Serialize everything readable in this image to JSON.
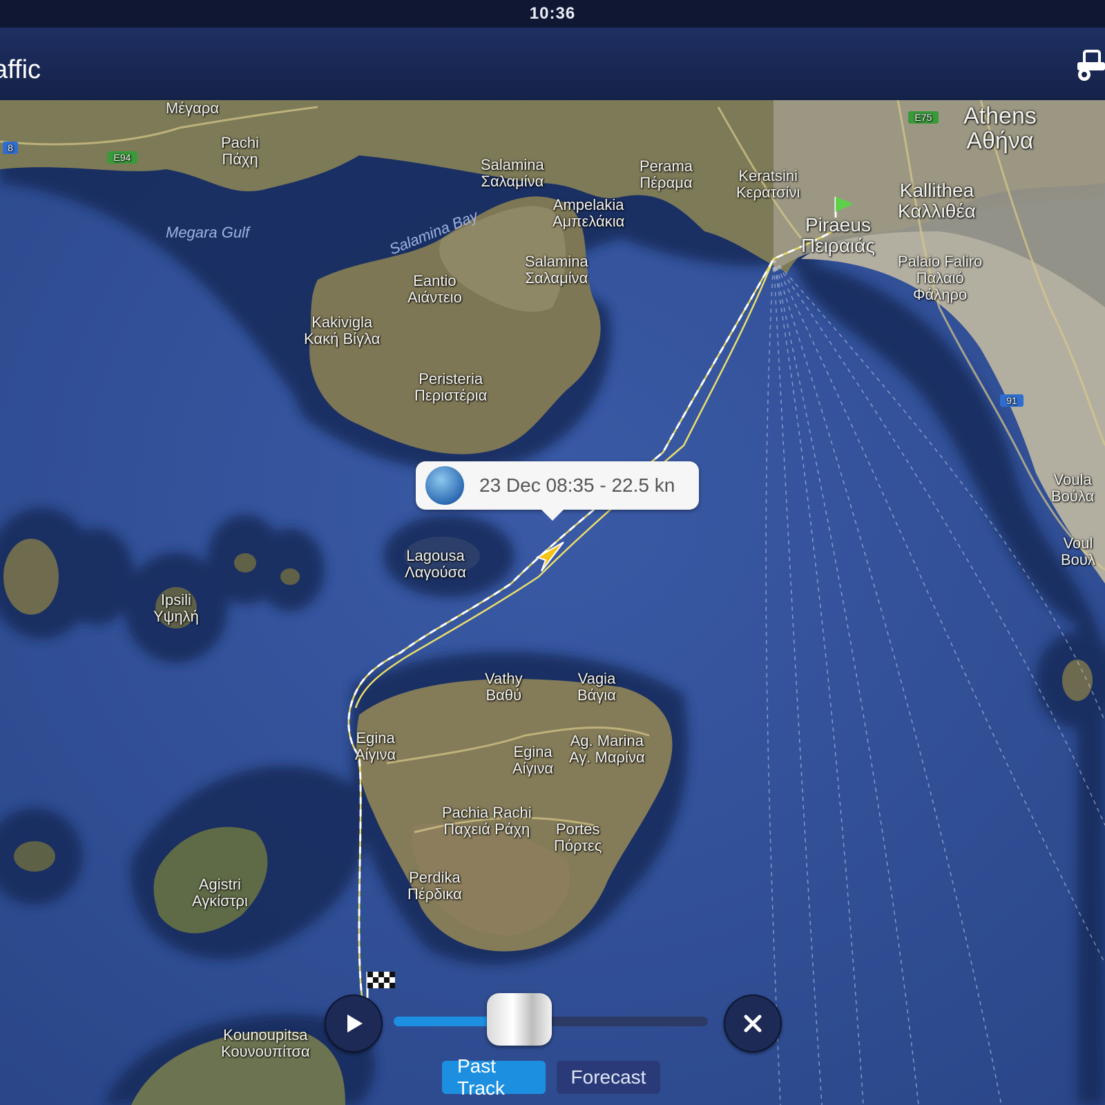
{
  "status_bar": {
    "time": "10:36"
  },
  "nav": {
    "title": "affic",
    "right_icon": "tractor-icon"
  },
  "map": {
    "places": {
      "megara": "Μέγαρα",
      "pachi": "Pachi\nΠάχη",
      "salamina_n": "Salamina\nΣαλαμίνα",
      "perama": "Perama\nΠέραμα",
      "keratsini": "Keratsini\nΚερατσίνι",
      "athens": "Athens\nΑθήνα",
      "kallithea": "Kallithea\nΚαλλιθέα",
      "piraeus": "Piraeus\nΠειραιάς",
      "ampelakia": "Ampelakia\nΑμπελάκια",
      "salamina_c": "Salamina\nΣαλαμίνα",
      "eantio": "Eantio\nΑιάντειο",
      "kakivigla": "Kakivigla\nΚακή Βίγλα",
      "perristeria": "Peristeria\nΠεριστέρια",
      "palaio_faliro": "Palaio Faliro\nΠαλαιό\nΦάληρο",
      "voula": "Voula\nΒούλα",
      "vouliagmeni": "Voul\nΒουλ",
      "lagousa": "Lagousa\nΛαγούσα",
      "ipsili": "Ipsili\nΥψηλή",
      "vathy": "Vathy\nΒαθύ",
      "vagia": "Vagia\nΒάγια",
      "egina_w": "Egina\nΑίγινα",
      "egina_c": "Egina\nΑίγινα",
      "agia_marina": "Ag. Marina\nΑγ. Μαρίνα",
      "pachia_rachi": "Pachia Rachi\nΠαχειά Ράχη",
      "portes": "Portes\nΠόρτες",
      "agistri": "Agistri\nΑγκίστρι",
      "perdika": "Perdika\nΠέρδικα",
      "kounoupitsa": "Kounoupitsa\nΚουνουπίτσα"
    },
    "water_labels": {
      "megara_gulf": "Megara Gulf",
      "salamina_bay": "Salamina Bay"
    },
    "road_labels": {
      "e94": "E94",
      "e75": "E75",
      "r91": "91",
      "r8": "8"
    }
  },
  "vessel_popup": {
    "icon": "vessel-photo-icon",
    "text": "23 Dec 08:35 - 22.5 kn"
  },
  "playback": {
    "play_icon": "play-icon",
    "close_icon": "close-icon",
    "progress": 0.4
  },
  "tabs": [
    {
      "label": "Past Track",
      "active": true
    },
    {
      "label": "Forecast",
      "active": false
    }
  ],
  "colors": {
    "sea": "#2e4c90",
    "land": "#8a7d5a",
    "track": "#e8e070",
    "accent": "#1d8fe0",
    "nav_bg": "#152248"
  }
}
